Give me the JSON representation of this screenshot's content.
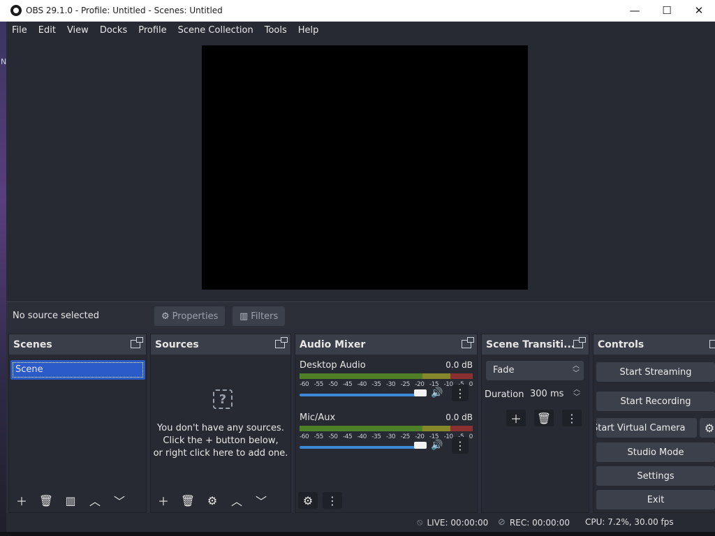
{
  "window": {
    "title": "OBS 29.1.0 - Profile: Untitled - Scenes: Untitled",
    "minimize": "—",
    "maximize": "☐",
    "close": "✕"
  },
  "desktop": {
    "edge_letter": "N"
  },
  "menu": [
    "File",
    "Edit",
    "View",
    "Docks",
    "Profile",
    "Scene Collection",
    "Tools",
    "Help"
  ],
  "context": {
    "label": "No source selected",
    "properties": "Properties",
    "filters": "Filters"
  },
  "docks": {
    "scenes": "Scenes",
    "sources": "Sources",
    "audio_mixer": "Audio Mixer",
    "transitions": "Scene Transiti...",
    "controls": "Controls"
  },
  "scenes": {
    "items": [
      "Scene"
    ]
  },
  "sources": {
    "empty_line1": "You don't have any sources.",
    "empty_line2": "Click the + button below,",
    "empty_line3": "or right click here to add one."
  },
  "mixer": {
    "channels": [
      {
        "name": "Desktop Audio",
        "db": "0.0 dB",
        "volume": 1.0
      },
      {
        "name": "Mic/Aux",
        "db": "0.0 dB",
        "volume": 1.0
      }
    ],
    "ticks": [
      "-60",
      "-55",
      "-50",
      "-45",
      "-40",
      "-35",
      "-30",
      "-25",
      "-20",
      "-15",
      "-10",
      "-5",
      "0"
    ]
  },
  "transitions": {
    "selected": "Fade",
    "duration_label": "Duration",
    "duration_value": "300 ms"
  },
  "controls": {
    "start_streaming": "Start Streaming",
    "start_recording": "Start Recording",
    "start_virtual_camera": "Start Virtual Camera",
    "studio_mode": "Studio Mode",
    "settings": "Settings",
    "exit": "Exit"
  },
  "status": {
    "live": "LIVE: 00:00:00",
    "rec": "REC: 00:00:00",
    "cpu": "CPU: 7.2%, 30.00 fps"
  },
  "colors": {
    "accent": "#2a5bc8",
    "meter_green": "#5a8a2a",
    "meter_yellow": "#8a8a20",
    "meter_red": "#8a2a2a"
  }
}
